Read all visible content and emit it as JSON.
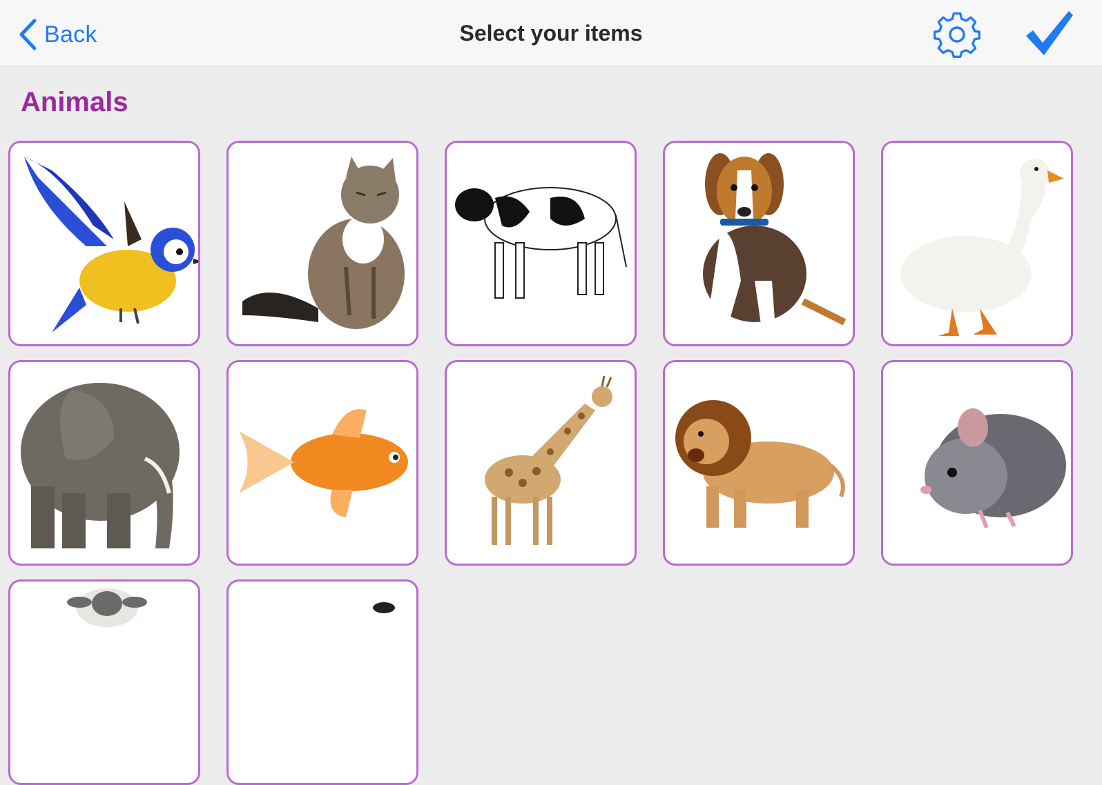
{
  "navbar": {
    "back_label": "Back",
    "title": "Select your items",
    "settings_icon": "gear-icon",
    "confirm_icon": "checkmark-icon"
  },
  "section": {
    "title": "Animals",
    "color": "#9b2a9e"
  },
  "colors": {
    "accent": "#1f7cf0",
    "tile_border": "#b86bcf",
    "background": "#ececec"
  },
  "items": [
    {
      "name": "bird",
      "icon": "bird-image"
    },
    {
      "name": "cat",
      "icon": "cat-image"
    },
    {
      "name": "cow",
      "icon": "cow-image"
    },
    {
      "name": "dog",
      "icon": "dog-image"
    },
    {
      "name": "duck",
      "icon": "duck-image"
    },
    {
      "name": "elephant",
      "icon": "elephant-image"
    },
    {
      "name": "fish",
      "icon": "fish-image"
    },
    {
      "name": "giraffe",
      "icon": "giraffe-image"
    },
    {
      "name": "lion",
      "icon": "lion-image"
    },
    {
      "name": "mouse",
      "icon": "mouse-image"
    },
    {
      "name": "sheep",
      "icon": "sheep-image"
    },
    {
      "name": "partial-animal",
      "icon": "animal-image"
    }
  ]
}
